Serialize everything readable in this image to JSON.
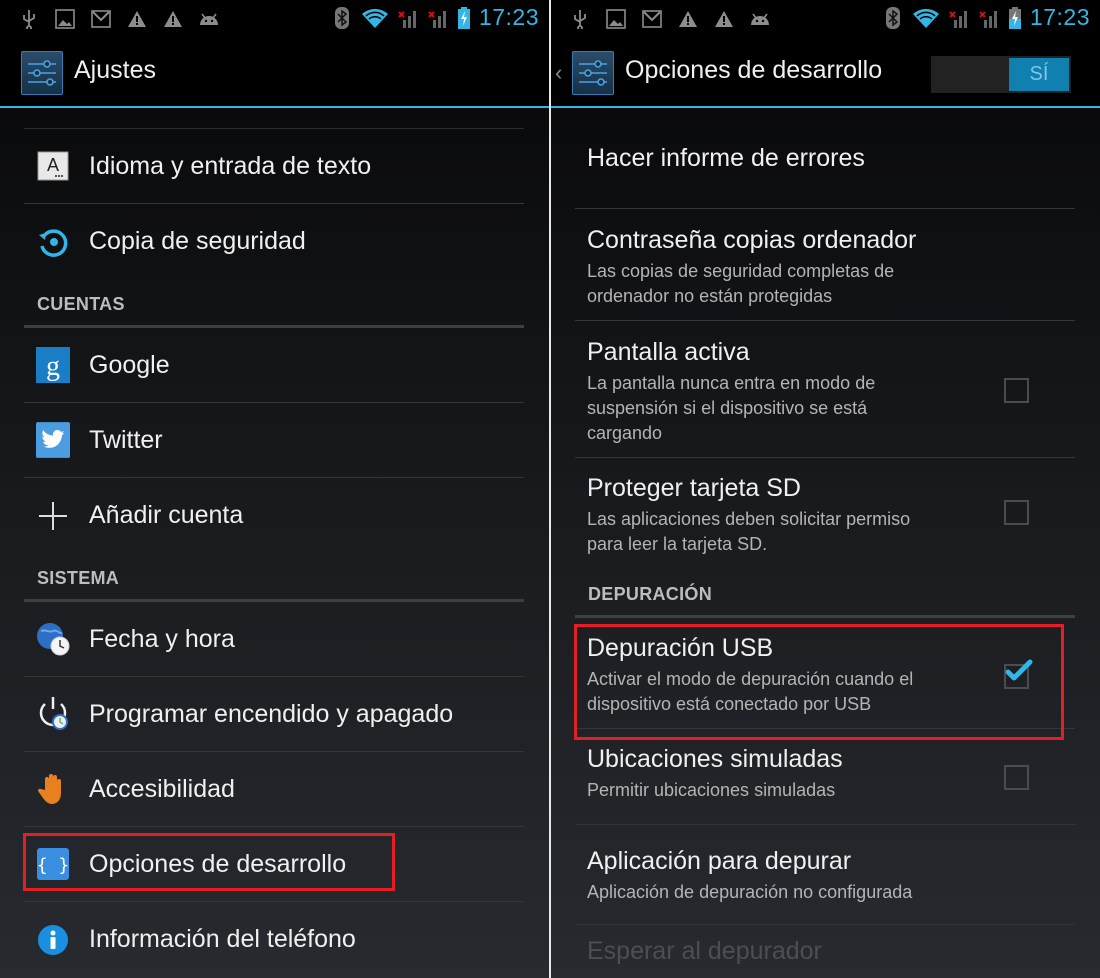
{
  "status_bar": {
    "left_icons": [
      "usb-icon",
      "image-icon",
      "gmail-icon",
      "warning-icon",
      "warning-icon",
      "android-icon"
    ],
    "right_icons": [
      "bluetooth-icon",
      "wifi-icon",
      "signal-no-sim-icon",
      "signal-no-sim-icon",
      "battery-charging-icon"
    ],
    "time": "17:23",
    "accent_color": "#33b5e5"
  },
  "left_screen": {
    "action_bar": {
      "title": "Ajustes",
      "icon": "settings-sliders-icon"
    },
    "items": [
      {
        "type": "item",
        "label": "Idioma y entrada de texto",
        "icon": "keyboard-a-icon"
      },
      {
        "type": "item",
        "label": "Copia de seguridad",
        "icon": "backup-icon"
      },
      {
        "type": "section",
        "label": "CUENTAS"
      },
      {
        "type": "item",
        "label": "Google",
        "icon": "google-icon"
      },
      {
        "type": "item",
        "label": "Twitter",
        "icon": "twitter-icon"
      },
      {
        "type": "item",
        "label": "Añadir cuenta",
        "icon": "plus-icon"
      },
      {
        "type": "section",
        "label": "SISTEMA"
      },
      {
        "type": "item",
        "label": "Fecha y hora",
        "icon": "globe-clock-icon"
      },
      {
        "type": "item",
        "label": "Programar encendido y apagado",
        "icon": "power-clock-icon"
      },
      {
        "type": "item",
        "label": "Accesibilidad",
        "icon": "hand-icon"
      },
      {
        "type": "item",
        "label": "Opciones de desarrollo",
        "icon": "developer-braces-icon",
        "highlighted": true
      },
      {
        "type": "item",
        "label": "Información del teléfono",
        "icon": "info-icon"
      }
    ]
  },
  "right_screen": {
    "action_bar": {
      "title": "Opciones de desarrollo",
      "icon": "settings-sliders-icon",
      "back": "‹",
      "toggle_label": "SÍ",
      "toggle_on": true
    },
    "items": [
      {
        "title": "Hacer informe de errores",
        "summary": ""
      },
      {
        "title": "Contraseña copias ordenador",
        "summary": "Las copias de seguridad completas de ordenador no están protegidas"
      },
      {
        "title": "Pantalla activa",
        "summary": "La pantalla nunca entra en modo de suspensión si el dispositivo se está cargando",
        "checkbox": true,
        "checked": false
      },
      {
        "title": "Proteger tarjeta SD",
        "summary": "Las aplicaciones deben solicitar permiso para leer la tarjeta SD.",
        "checkbox": true,
        "checked": false
      },
      {
        "section": "DEPURACIÓN"
      },
      {
        "title": "Depuración USB",
        "summary": "Activar el modo de depuración cuando el dispositivo está conectado por USB",
        "checkbox": true,
        "checked": true,
        "highlighted": true
      },
      {
        "title": "Ubicaciones simuladas",
        "summary": "Permitir ubicaciones simuladas",
        "checkbox": true,
        "checked": false
      },
      {
        "title": "Aplicación para depurar",
        "summary": "Aplicación de depuración no configurada"
      },
      {
        "title": "Esperar al depurador",
        "summary": "",
        "disabled": true
      }
    ]
  },
  "highlight_color": "#e31e25"
}
